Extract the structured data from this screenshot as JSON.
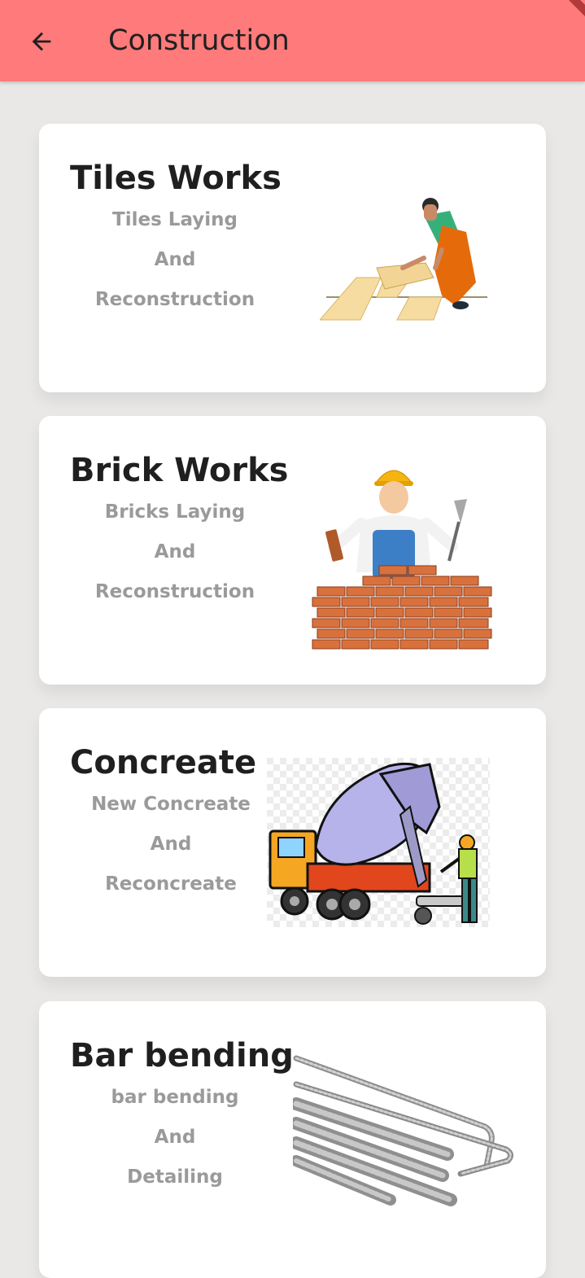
{
  "appbar": {
    "title": "Construction",
    "background": "#ff7a7a"
  },
  "cards": [
    {
      "title": "Tiles Works",
      "lines": [
        "Tiles Laying",
        "And",
        "Reconstruction"
      ],
      "icon": "tiler-illustration"
    },
    {
      "title": "Brick Works",
      "lines": [
        "Bricks Laying",
        "And",
        "Reconstruction"
      ],
      "icon": "bricklayer-illustration"
    },
    {
      "title": "Concreate",
      "lines": [
        "New Concreate",
        "And",
        "Reconcreate"
      ],
      "icon": "concrete-mixer-illustration"
    },
    {
      "title": "Bar bending",
      "lines": [
        "bar bending",
        "And",
        "Detailing"
      ],
      "icon": "rebar-bars-illustration"
    }
  ]
}
